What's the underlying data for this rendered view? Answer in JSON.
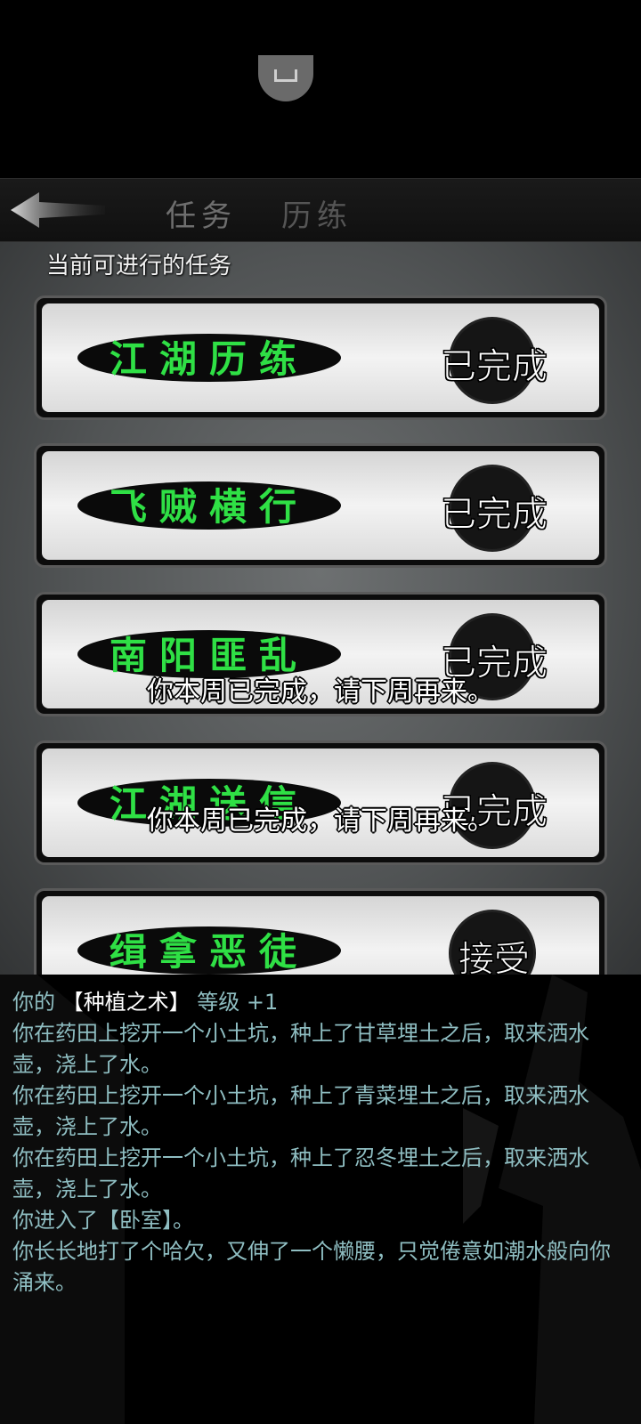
{
  "header": {
    "tabs": [
      {
        "label": "任务",
        "active": true
      },
      {
        "label": "历练",
        "active": false
      }
    ]
  },
  "section_title": "当前可进行的任务",
  "tasks": [
    {
      "name": "江湖历练",
      "status": "已完成"
    },
    {
      "name": "飞贼横行",
      "status": "已完成"
    },
    {
      "name": "南阳匪乱",
      "status": "已完成"
    },
    {
      "name": "江湖送信",
      "status": "已完成"
    },
    {
      "name": "缉拿恶徒",
      "status": "接受"
    }
  ],
  "toasts": [
    "你本周已完成，请下周再来。",
    "你本周已完成，请下周再来。"
  ],
  "log": {
    "skill_prefix": "你的 ",
    "skill_name": "【种植之术】",
    "skill_suffix": " 等级 +1",
    "lines": [
      "你在药田上挖开一个小土坑，种上了甘草埋土之后，取来洒水壶，浇上了水。",
      "你在药田上挖开一个小土坑，种上了青菜埋土之后，取来洒水壶，浇上了水。",
      "你在药田上挖开一个小土坑，种上了忍冬埋土之后，取来洒水壶，浇上了水。",
      "你进入了【卧室】。",
      "你长长地打了个哈欠，又伸了一个懒腰，只觉倦意如潮水般向你涌来。"
    ]
  },
  "colors": {
    "task_name_green": "#2fe045",
    "log_text": "#8fbec2",
    "highlight": "#ffffff"
  }
}
